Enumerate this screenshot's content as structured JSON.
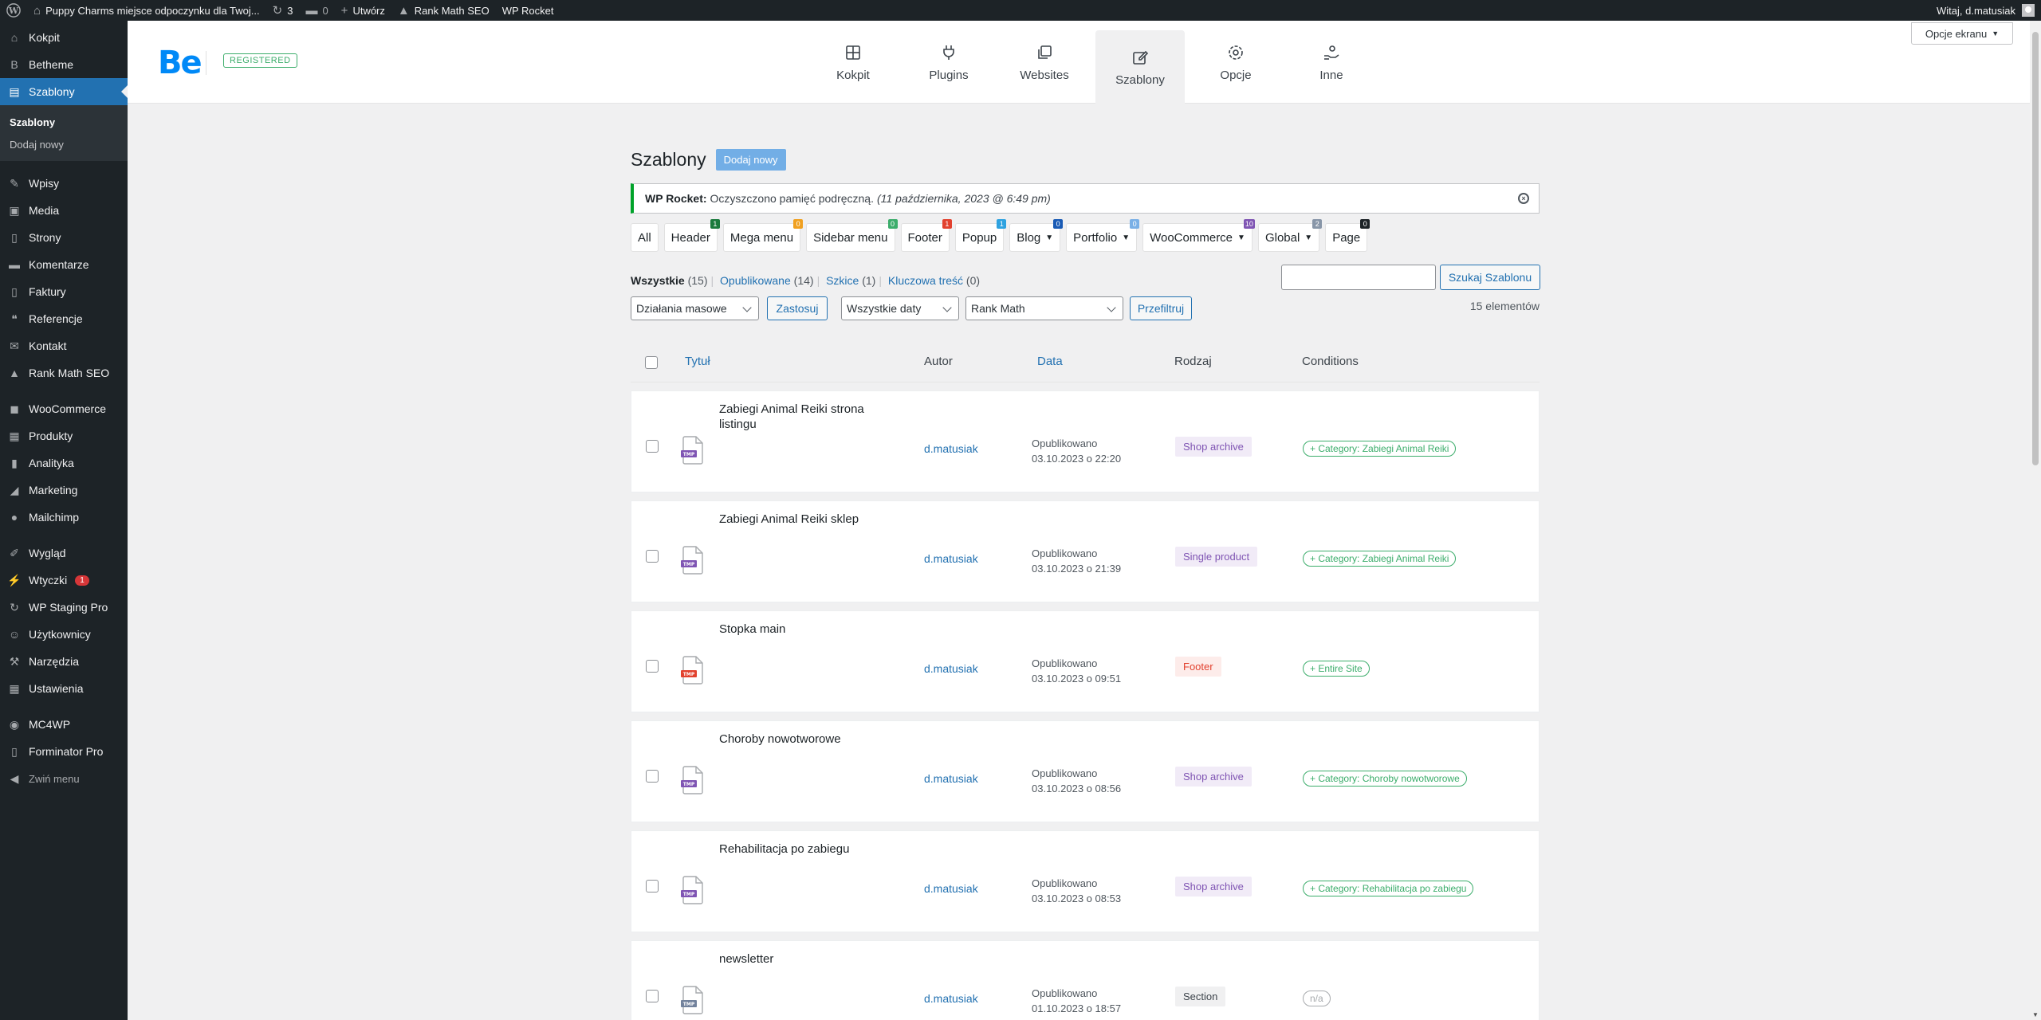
{
  "adminbar": {
    "site_name": "Puppy Charms miejsce odpoczynku dla Twoj...",
    "updates_count": "3",
    "comments_count": "0",
    "new_label": "Utwórz",
    "rank_math": "Rank Math SEO",
    "wp_rocket": "WP Rocket",
    "greeting": "Witaj, d.matusiak"
  },
  "sidebar": {
    "items": [
      {
        "label": "Kokpit",
        "icon": "dashboard-icon",
        "glyph": "⌂"
      },
      {
        "label": "Betheme",
        "icon": "betheme-icon",
        "glyph": "B"
      },
      {
        "label": "Szablony",
        "icon": "templates-icon",
        "glyph": "▤"
      },
      {
        "label": "Wpisy",
        "icon": "pin-icon",
        "glyph": "✎"
      },
      {
        "label": "Media",
        "icon": "media-icon",
        "glyph": "▣"
      },
      {
        "label": "Strony",
        "icon": "pages-icon",
        "glyph": "▯"
      },
      {
        "label": "Komentarze",
        "icon": "comments-icon",
        "glyph": "▬"
      },
      {
        "label": "Faktury",
        "icon": "invoices-icon",
        "glyph": "▯"
      },
      {
        "label": "Referencje",
        "icon": "quote-icon",
        "glyph": "❝"
      },
      {
        "label": "Kontakt",
        "icon": "mail-icon",
        "glyph": "✉"
      },
      {
        "label": "Rank Math SEO",
        "icon": "rankmath-icon",
        "glyph": "▲"
      },
      {
        "label": "WooCommerce",
        "icon": "woocommerce-icon",
        "glyph": "◼"
      },
      {
        "label": "Produkty",
        "icon": "products-icon",
        "glyph": "▦"
      },
      {
        "label": "Analityka",
        "icon": "analytics-icon",
        "glyph": "▮"
      },
      {
        "label": "Marketing",
        "icon": "marketing-icon",
        "glyph": "◢"
      },
      {
        "label": "Mailchimp",
        "icon": "mailchimp-icon",
        "glyph": "●"
      },
      {
        "label": "Wygląd",
        "icon": "appearance-icon",
        "glyph": "✐"
      },
      {
        "label": "Wtyczki",
        "icon": "plugins-icon",
        "glyph": "⚡"
      },
      {
        "label": "WP Staging Pro",
        "icon": "staging-icon",
        "glyph": "↻"
      },
      {
        "label": "Użytkownicy",
        "icon": "users-icon",
        "glyph": "☺"
      },
      {
        "label": "Narzędzia",
        "icon": "tools-icon",
        "glyph": "⚒"
      },
      {
        "label": "Ustawienia",
        "icon": "settings-icon",
        "glyph": "▦"
      },
      {
        "label": "MC4WP",
        "icon": "mc4wp-icon",
        "glyph": "◉"
      },
      {
        "label": "Forminator Pro",
        "icon": "forminator-icon",
        "glyph": "▯"
      }
    ],
    "sub_current": "Szablony",
    "sub_add_new": "Dodaj nowy",
    "plugins_badge": "1",
    "collapse_label": "Zwiń menu"
  },
  "be_header": {
    "logo": "Be",
    "registered": "REGISTERED",
    "tabs": [
      {
        "label": "Kokpit",
        "icon": "dashboard-grid-icon"
      },
      {
        "label": "Plugins",
        "icon": "plug-icon"
      },
      {
        "label": "Websites",
        "icon": "websites-icon"
      },
      {
        "label": "Szablony",
        "icon": "templates-edit-icon"
      },
      {
        "label": "Opcje",
        "icon": "options-gear-icon"
      },
      {
        "label": "Inne",
        "icon": "other-hand-icon"
      }
    ],
    "screen_options": "Opcje ekranu"
  },
  "page": {
    "title": "Szablony",
    "add_new": "Dodaj nowy",
    "notice": {
      "source": "WP Rocket:",
      "message": "Oczyszczono pamięć podręczną.",
      "time": "(11 października, 2023 @ 6:49 pm)"
    },
    "type_filters": [
      {
        "label": "All",
        "count": "",
        "color": "",
        "dropdown": false
      },
      {
        "label": "Header",
        "count": "1",
        "color": "#1a7a3c",
        "dropdown": false
      },
      {
        "label": "Mega menu",
        "count": "0",
        "color": "#f0a020",
        "dropdown": false
      },
      {
        "label": "Sidebar menu",
        "count": "0",
        "color": "#3cad6b",
        "dropdown": false
      },
      {
        "label": "Footer",
        "count": "1",
        "color": "#e2412e",
        "dropdown": false
      },
      {
        "label": "Popup",
        "count": "1",
        "color": "#2ea2e0",
        "dropdown": false
      },
      {
        "label": "Blog",
        "count": "0",
        "color": "#1a5bb5",
        "dropdown": true
      },
      {
        "label": "Portfolio",
        "count": "0",
        "color": "#7ab0e6",
        "dropdown": true
      },
      {
        "label": "WooCommerce",
        "count": "10",
        "color": "#7f54b3",
        "dropdown": true
      },
      {
        "label": "Global",
        "count": "2",
        "color": "#8896a8",
        "dropdown": true
      },
      {
        "label": "Page",
        "count": "0",
        "color": "#1d2327",
        "dropdown": false
      }
    ],
    "views": {
      "all": "Wszystkie",
      "all_count": "(15)",
      "published": "Opublikowane",
      "published_count": "(14)",
      "drafts": "Szkice",
      "drafts_count": "(1)",
      "cornerstone": "Kluczowa treść",
      "cornerstone_count": "(0)"
    },
    "search_value": "",
    "search_button": "Szukaj Szablonu",
    "bulk_actions": "Działania masowe",
    "apply": "Zastosuj",
    "all_dates": "Wszystkie daty",
    "rank_math_filter": "Rank Math",
    "filter": "Przefiltruj",
    "item_count": "15 elementów",
    "columns": {
      "title": "Tytuł",
      "author": "Autor",
      "date": "Data",
      "type": "Rodzaj",
      "conditions": "Conditions"
    },
    "rows": [
      {
        "title": "Zabiegi Animal Reiki strona listingu",
        "author": "d.matusiak",
        "status": "Opublikowano",
        "date": "03.10.2023 o 22:20",
        "kind": "Shop archive",
        "kind_color": "#7f54b3",
        "kind_bg": "#f1ebf7",
        "condition": "+ Category: Zabiegi Animal Reiki",
        "cond_color": "#3cad6b",
        "file_color": "#7f54b3",
        "file_label": "TMP"
      },
      {
        "title": "Zabiegi Animal Reiki sklep",
        "author": "d.matusiak",
        "status": "Opublikowano",
        "date": "03.10.2023 o 21:39",
        "kind": "Single product",
        "kind_color": "#7f54b3",
        "kind_bg": "#f1ebf7",
        "condition": "+ Category: Zabiegi Animal Reiki",
        "cond_color": "#3cad6b",
        "file_color": "#7f54b3",
        "file_label": "TMP"
      },
      {
        "title": "Stopka main",
        "author": "d.matusiak",
        "status": "Opublikowano",
        "date": "03.10.2023 o 09:51",
        "kind": "Footer",
        "kind_color": "#e2412e",
        "kind_bg": "#fdecea",
        "condition": "+ Entire Site",
        "cond_color": "#3cad6b",
        "file_color": "#e2412e",
        "file_label": "TMP"
      },
      {
        "title": "Choroby nowotworowe",
        "author": "d.matusiak",
        "status": "Opublikowano",
        "date": "03.10.2023 o 08:56",
        "kind": "Shop archive",
        "kind_color": "#7f54b3",
        "kind_bg": "#f1ebf7",
        "condition": "+ Category: Choroby nowotworowe",
        "cond_color": "#3cad6b",
        "file_color": "#7f54b3",
        "file_label": "TMP"
      },
      {
        "title": "Rehabilitacja po zabiegu",
        "author": "d.matusiak",
        "status": "Opublikowano",
        "date": "03.10.2023 o 08:53",
        "kind": "Shop archive",
        "kind_color": "#7f54b3",
        "kind_bg": "#f1ebf7",
        "condition": "+ Category: Rehabilitacja po zabiegu",
        "cond_color": "#3cad6b",
        "file_color": "#7f54b3",
        "file_label": "TMP"
      },
      {
        "title": "newsletter",
        "author": "d.matusiak",
        "status": "Opublikowano",
        "date": "01.10.2023 o 18:57",
        "kind": "Section",
        "kind_color": "#3c434a",
        "kind_bg": "#f0f0f1",
        "condition": "n/a",
        "cond_color": "#a7aaad",
        "file_color": "#72829c",
        "file_label": "TMP"
      }
    ]
  }
}
